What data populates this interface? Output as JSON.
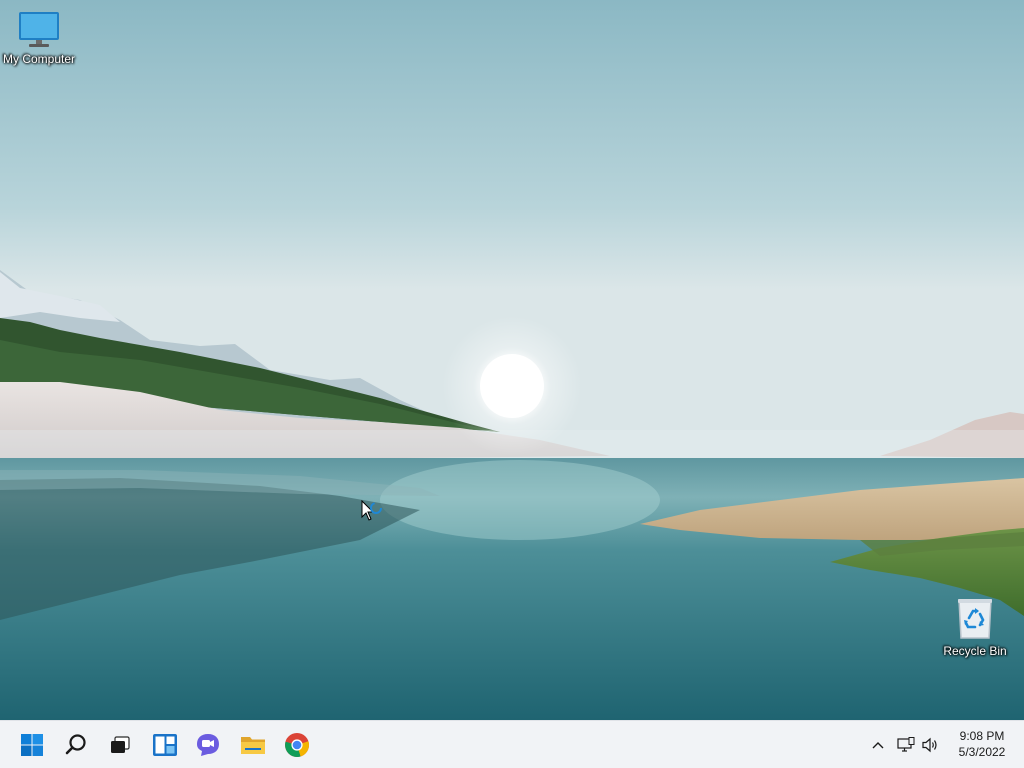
{
  "desktop": {
    "icons": [
      {
        "label": "My Computer",
        "icon": "monitor-icon"
      },
      {
        "label": "Recycle Bin",
        "icon": "recycle-bin-icon"
      }
    ]
  },
  "taskbar": {
    "pinned": [
      {
        "name": "Start",
        "icon": "windows-start-icon"
      },
      {
        "name": "Search",
        "icon": "search-icon"
      },
      {
        "name": "Task View",
        "icon": "task-view-icon"
      },
      {
        "name": "Widgets",
        "icon": "widgets-icon"
      },
      {
        "name": "Chat",
        "icon": "chat-icon"
      },
      {
        "name": "File Explorer",
        "icon": "folder-icon"
      },
      {
        "name": "Google Chrome",
        "icon": "chrome-icon"
      }
    ],
    "tray": {
      "icons": [
        "chevron-up-icon",
        "network-icon",
        "volume-icon"
      ],
      "time": "9:08 PM",
      "date": "5/3/2022"
    }
  },
  "colors": {
    "taskbar_bg": "#f1f3f6",
    "start_blue": "#0078d4",
    "sky_top": "#8fbac6",
    "water": "#2e7a86"
  }
}
